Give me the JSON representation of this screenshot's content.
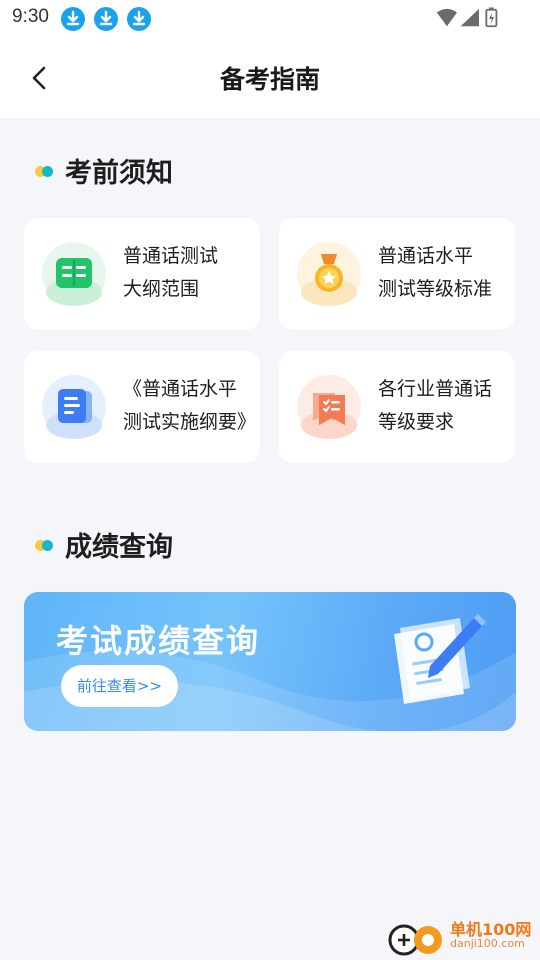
{
  "status_bar": {
    "time": "9:30",
    "icons": [
      "download-icon",
      "download-icon",
      "download-icon",
      "wifi-icon",
      "signal-icon",
      "battery-charging-icon"
    ]
  },
  "header": {
    "title": "备考指南",
    "back_icon": "chevron-left-icon"
  },
  "sections": {
    "pre_exam": {
      "title": "考前须知",
      "cards": [
        {
          "line1": "普通话测试",
          "line2": "大纲范围",
          "icon": "book-icon",
          "color": "#22c468"
        },
        {
          "line1": "普通话水平",
          "line2": "测试等级标准",
          "icon": "medal-icon",
          "color": "#f5b520"
        },
        {
          "line1": "《普通话水平",
          "line2": "测试实施纲要》",
          "icon": "document-icon",
          "color": "#3d7cf3"
        },
        {
          "line1": "各行业普通话",
          "line2": "等级要求",
          "icon": "checklist-icon",
          "color": "#f27a55"
        }
      ]
    },
    "score": {
      "title": "成绩查询",
      "banner_title": "考试成绩查询",
      "banner_button": "前往查看>>"
    }
  },
  "watermark": {
    "brand": "单机100网",
    "url": "danji100.com"
  }
}
